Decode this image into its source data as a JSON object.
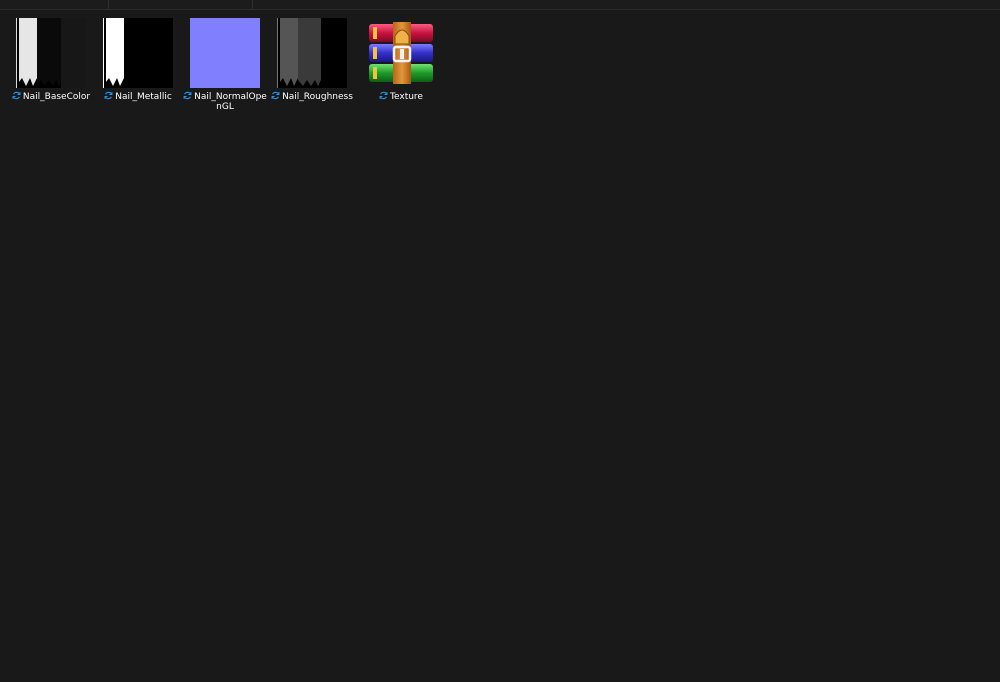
{
  "explorer": {
    "files": [
      {
        "name": "Nail_BaseColor",
        "status_icon": "sync-icon",
        "type": "image"
      },
      {
        "name": "Nail_Metallic",
        "status_icon": "sync-icon",
        "type": "image"
      },
      {
        "name": "Nail_NormalOpenGL",
        "status_icon": "sync-icon",
        "type": "image"
      },
      {
        "name": "Nail_Roughness",
        "status_icon": "sync-icon",
        "type": "image"
      },
      {
        "name": "Texture",
        "status_icon": "sync-icon",
        "type": "archive"
      }
    ]
  },
  "colors": {
    "background": "#191919",
    "sync_blue": "#2f8fd8",
    "normal_map": "#8080ff"
  }
}
